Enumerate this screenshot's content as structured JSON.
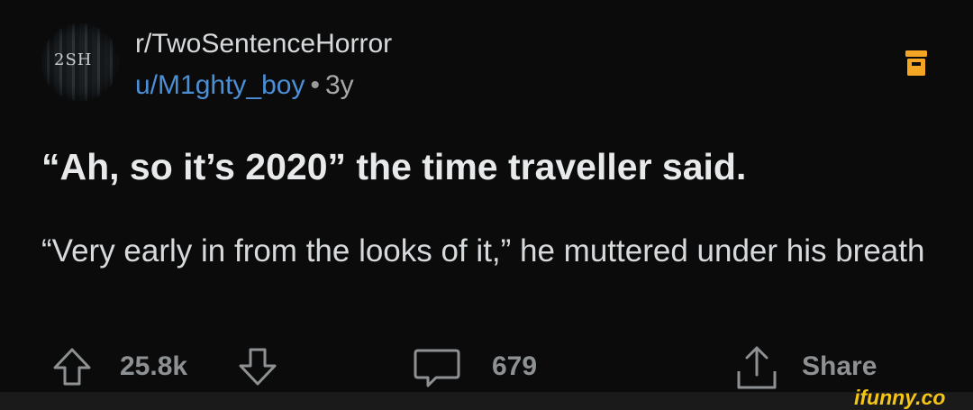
{
  "header": {
    "avatar_text": "2SH",
    "subreddit": "r/TwoSentenceHorror",
    "username": "u/M1ghty_boy",
    "separator": "•",
    "age": "3y"
  },
  "post": {
    "title": "“Ah, so it’s 2020” the time traveller said.",
    "body": "“Very early in from the looks of it,” he muttered under his breath"
  },
  "actions": {
    "score": "25.8k",
    "comments": "679",
    "share_label": "Share"
  },
  "icons": {
    "save": "save-icon",
    "upvote": "upvote-arrow-icon",
    "downvote": "downvote-arrow-icon",
    "comment": "comment-bubble-icon",
    "share": "share-icon"
  },
  "colors": {
    "background": "#0b0b0b",
    "username": "#4b8fd6",
    "save_icon": "#f5a524",
    "watermark": "#f5c518"
  },
  "watermark": "ifunny.co"
}
